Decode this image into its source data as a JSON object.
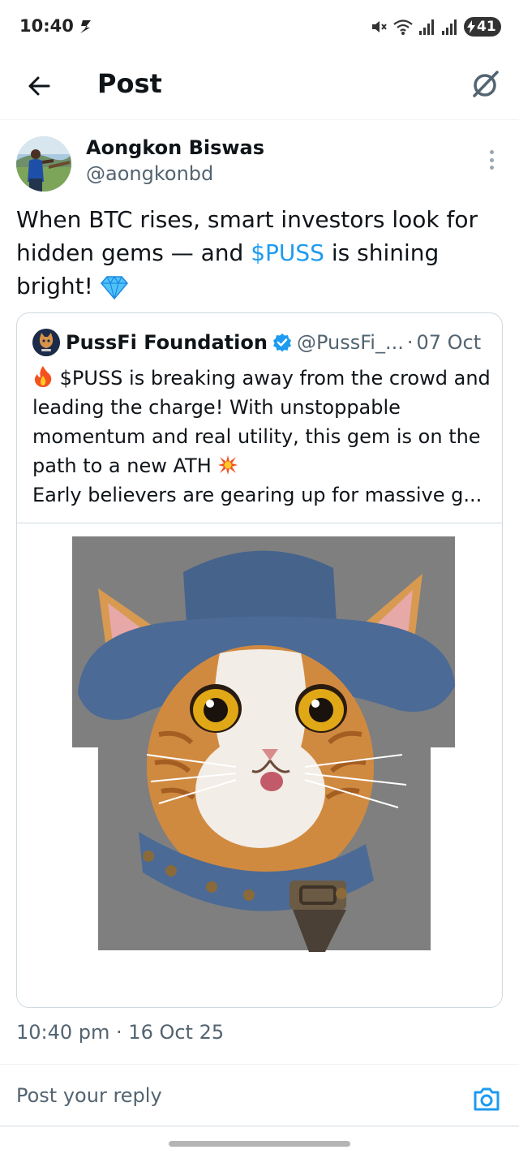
{
  "status_bar": {
    "time": "10:40",
    "battery": "41"
  },
  "header": {
    "title": "Post"
  },
  "post": {
    "author_name": "Aongkon Biswas",
    "author_handle": "@aongkonbd",
    "text_before": "When BTC rises, smart investors look for hidden gems — and ",
    "cashtag": "$PUSS",
    "text_after": " is shining bright! ",
    "timestamp": "10:40 pm · 16 Oct 25"
  },
  "quote": {
    "name": "PussFi Foundation",
    "handle": "@PussFi_...",
    "separator": "·",
    "date": "07 Oct",
    "line1": " $PUSS is breaking away from the crowd and leading the charge! With unstoppable momentum and real utility, this gem is on the path to a new ATH ",
    "line2": "Early believers are gearing up for massive g..."
  },
  "reply": {
    "placeholder": "Post your reply"
  },
  "colors": {
    "accent": "#1d9bf0",
    "secondary_text": "#536471",
    "border": "#cfd9de"
  }
}
